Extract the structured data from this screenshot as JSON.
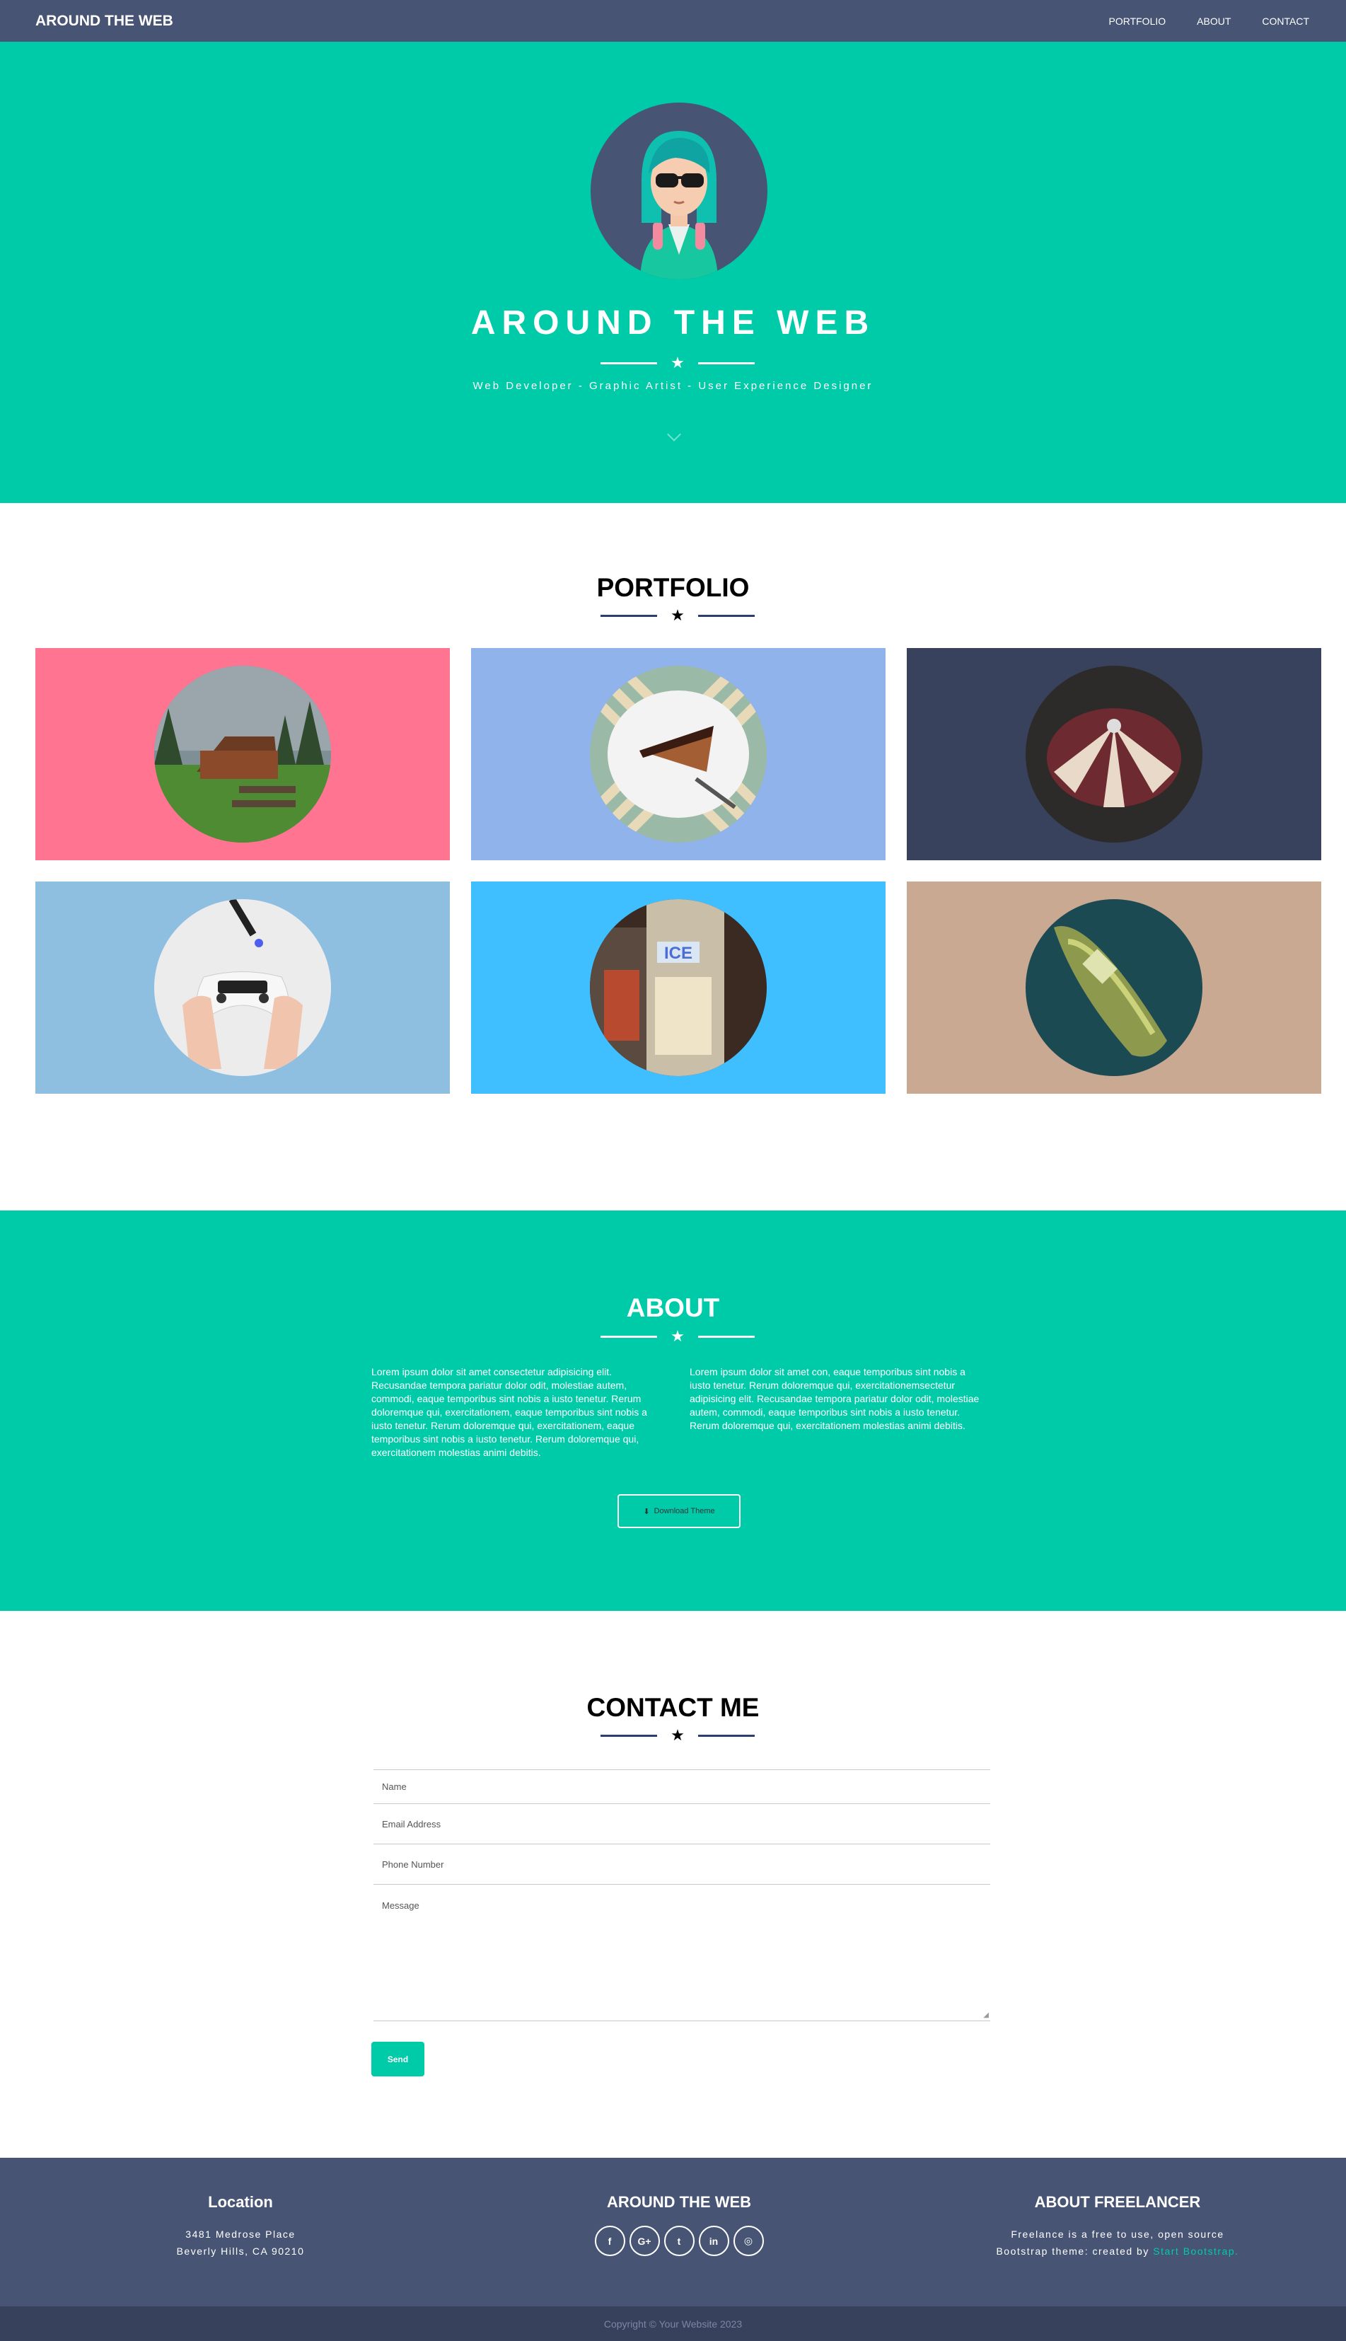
{
  "nav": {
    "brand": "AROUND THE WEB",
    "links": [
      "PORTFOLIO",
      "ABOUT",
      "CONTACT"
    ]
  },
  "hero": {
    "title": "AROUND THE WEB",
    "subtitle": "Web Developer - Graphic Artist - User Experience Designer"
  },
  "portfolio": {
    "title": "PORTFOLIO",
    "items": [
      {
        "image": "cabin-in-forest",
        "bg": "#ff7591"
      },
      {
        "image": "cake-slice",
        "bg": "#8fb3ea"
      },
      {
        "image": "circus-tent",
        "bg": "#38425d"
      },
      {
        "image": "game-controller",
        "bg": "#8fbfe0"
      },
      {
        "image": "ice-machine",
        "bg": "#3fbfff"
      },
      {
        "image": "boat-on-water",
        "bg": "#caa992"
      }
    ]
  },
  "about": {
    "title": "ABOUT",
    "col1": "Lorem ipsum dolor sit amet consectetur adipisicing elit. Recusandae tempora pariatur dolor odit, molestiae autem, commodi, eaque temporibus sint nobis a iusto tenetur. Rerum doloremque qui, exercitationem, eaque temporibus sint nobis a iusto tenetur. Rerum doloremque qui, exercitationem, eaque temporibus sint nobis a iusto tenetur. Rerum doloremque qui, exercitationem molestias animi debitis.",
    "col2": "Lorem ipsum dolor sit amet con, eaque temporibus sint nobis a iusto tenetur. Rerum doloremque qui, exercitationemsectetur adipisicing elit. Recusandae tempora pariatur dolor odit, molestiae autem, commodi, eaque temporibus sint nobis a iusto tenetur. Rerum doloremque qui, exercitationem molestias animi debitis.",
    "button": "Download Theme"
  },
  "contact": {
    "title": "CONTACT ME",
    "fields": {
      "name": "Name",
      "email": "Email Address",
      "phone": "Phone Number",
      "message": "Message"
    },
    "send": "Send"
  },
  "footer": {
    "location": {
      "title": "Location",
      "line1": "3481 Medrose Place",
      "line2": "Beverly Hills, CA 90210"
    },
    "social": {
      "title": "AROUND THE WEB",
      "icons": [
        "facebook-icon",
        "google-plus-icon",
        "twitter-icon",
        "linkedin-icon",
        "dribbble-icon"
      ],
      "glyphs": [
        "f",
        "G+",
        "t",
        "in",
        "◎"
      ]
    },
    "about": {
      "title": "ABOUT FREELANCER",
      "text1": "Freelance is a free to use, open source",
      "text2": "Bootstrap theme: created by",
      "link": "Start Bootstrap."
    },
    "copyright": "Copyright © Your Website 2023"
  },
  "colors": {
    "accent": "#00cba9",
    "navy": "#475474",
    "dark": "#38415b"
  }
}
